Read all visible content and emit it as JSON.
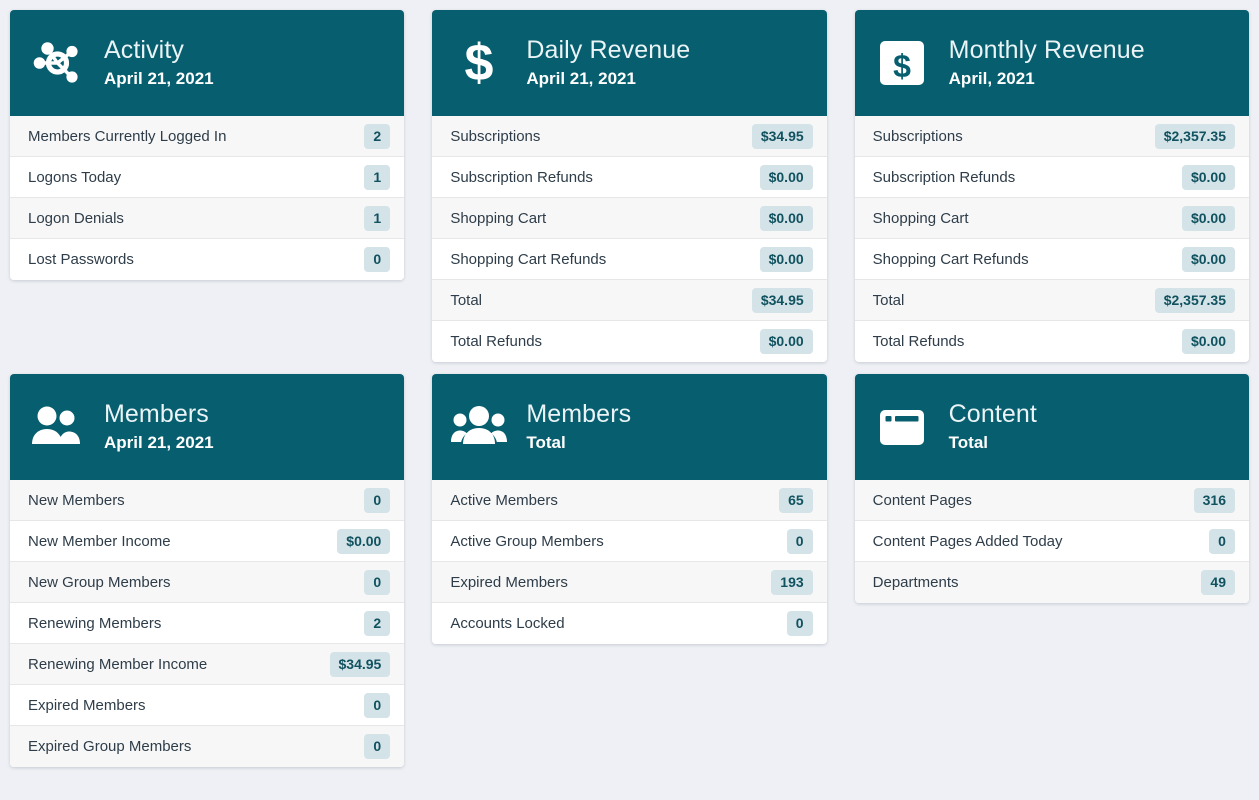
{
  "page": {
    "background_color": "#eef0f5",
    "header_color": "#065e6e",
    "badge_background": "#d4e3e8",
    "badge_text_color": "#10525f"
  },
  "cards": [
    {
      "id": "activity",
      "icon": "network-hub-icon",
      "title": "Activity",
      "subtitle": "April 21, 2021",
      "rows": [
        {
          "label": "Members Currently Logged In",
          "value": "2"
        },
        {
          "label": "Logons Today",
          "value": "1"
        },
        {
          "label": "Logon Denials",
          "value": "1"
        },
        {
          "label": "Lost Passwords",
          "value": "0"
        }
      ]
    },
    {
      "id": "daily-revenue",
      "icon": "dollar-sign-icon",
      "title": "Daily Revenue",
      "subtitle": "April 21, 2021",
      "rows": [
        {
          "label": "Subscriptions",
          "value": "$34.95"
        },
        {
          "label": "Subscription Refunds",
          "value": "$0.00"
        },
        {
          "label": "Shopping Cart",
          "value": "$0.00"
        },
        {
          "label": "Shopping Cart Refunds",
          "value": "$0.00"
        },
        {
          "label": "Total",
          "value": "$34.95"
        },
        {
          "label": "Total Refunds",
          "value": "$0.00"
        }
      ]
    },
    {
      "id": "monthly-revenue",
      "icon": "dollar-square-icon",
      "title": "Monthly Revenue",
      "subtitle": "April, 2021",
      "rows": [
        {
          "label": "Subscriptions",
          "value": "$2,357.35"
        },
        {
          "label": "Subscription Refunds",
          "value": "$0.00"
        },
        {
          "label": "Shopping Cart",
          "value": "$0.00"
        },
        {
          "label": "Shopping Cart Refunds",
          "value": "$0.00"
        },
        {
          "label": "Total",
          "value": "$2,357.35"
        },
        {
          "label": "Total Refunds",
          "value": "$0.00"
        }
      ]
    },
    {
      "id": "members-daily",
      "icon": "two-people-icon",
      "title": "Members",
      "subtitle": "April 21, 2021",
      "rows": [
        {
          "label": "New Members",
          "value": "0"
        },
        {
          "label": "New Member Income",
          "value": "$0.00"
        },
        {
          "label": "New Group Members",
          "value": "0"
        },
        {
          "label": "Renewing Members",
          "value": "2"
        },
        {
          "label": "Renewing Member Income",
          "value": "$34.95"
        },
        {
          "label": "Expired Members",
          "value": "0"
        },
        {
          "label": "Expired Group Members",
          "value": "0"
        }
      ]
    },
    {
      "id": "members-total",
      "icon": "three-people-group-icon",
      "title": "Members",
      "subtitle": "Total",
      "rows": [
        {
          "label": "Active Members",
          "value": "65"
        },
        {
          "label": "Active Group Members",
          "value": "0"
        },
        {
          "label": "Expired Members",
          "value": "193"
        },
        {
          "label": "Accounts Locked",
          "value": "0"
        }
      ]
    },
    {
      "id": "content",
      "icon": "browser-window-icon",
      "title": "Content",
      "subtitle": "Total",
      "rows": [
        {
          "label": "Content Pages",
          "value": "316"
        },
        {
          "label": "Content Pages Added Today",
          "value": "0"
        },
        {
          "label": "Departments",
          "value": "49"
        }
      ]
    }
  ]
}
